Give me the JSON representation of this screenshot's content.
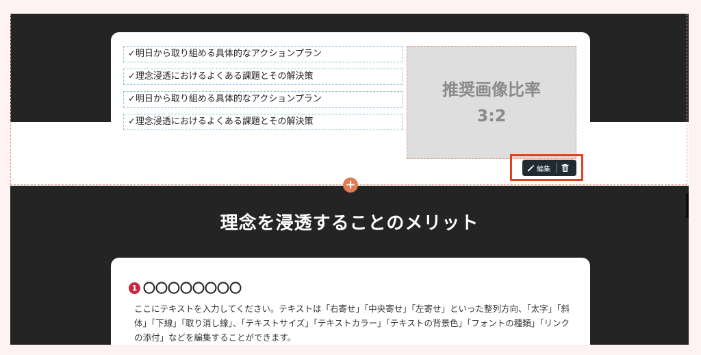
{
  "block_list": {
    "items": [
      {
        "check": "✓",
        "text": "明日から取り組める具体的なアクションプラン"
      },
      {
        "check": "✓",
        "text": "理念浸透におけるよくある課題とその解決策"
      },
      {
        "check": "✓",
        "text": "明日から取り組める具体的なアクションプラン"
      },
      {
        "check": "✓",
        "text": "理念浸透におけるよくある課題とその解決策"
      }
    ]
  },
  "image_placeholder": {
    "line1": "推奨画像比率",
    "line2": "3:2"
  },
  "toolbar": {
    "edit_label": "編集",
    "edit_icon": "pencil-icon",
    "delete_icon": "trash-icon"
  },
  "add_block": {
    "symbol": "+"
  },
  "section": {
    "title": "理念を浸透することのメリット"
  },
  "point": {
    "number": "1",
    "heading": "〇〇〇〇〇〇〇〇",
    "body": "ここにテキストを入力してください。テキストは「右寄せ」「中央寄せ」「左寄せ」といった整列方向、「太字」「斜体」「下線」「取り消し線」、「テキストサイズ」「テキストカラー」「テキストの背景色」「フォントの種類」「リンクの添付」などを編集することができます。"
  },
  "colors": {
    "dark_bg": "#242424",
    "accent_add": "#e07b52",
    "highlight": "#e2401b",
    "number_badge": "#c8283e"
  }
}
